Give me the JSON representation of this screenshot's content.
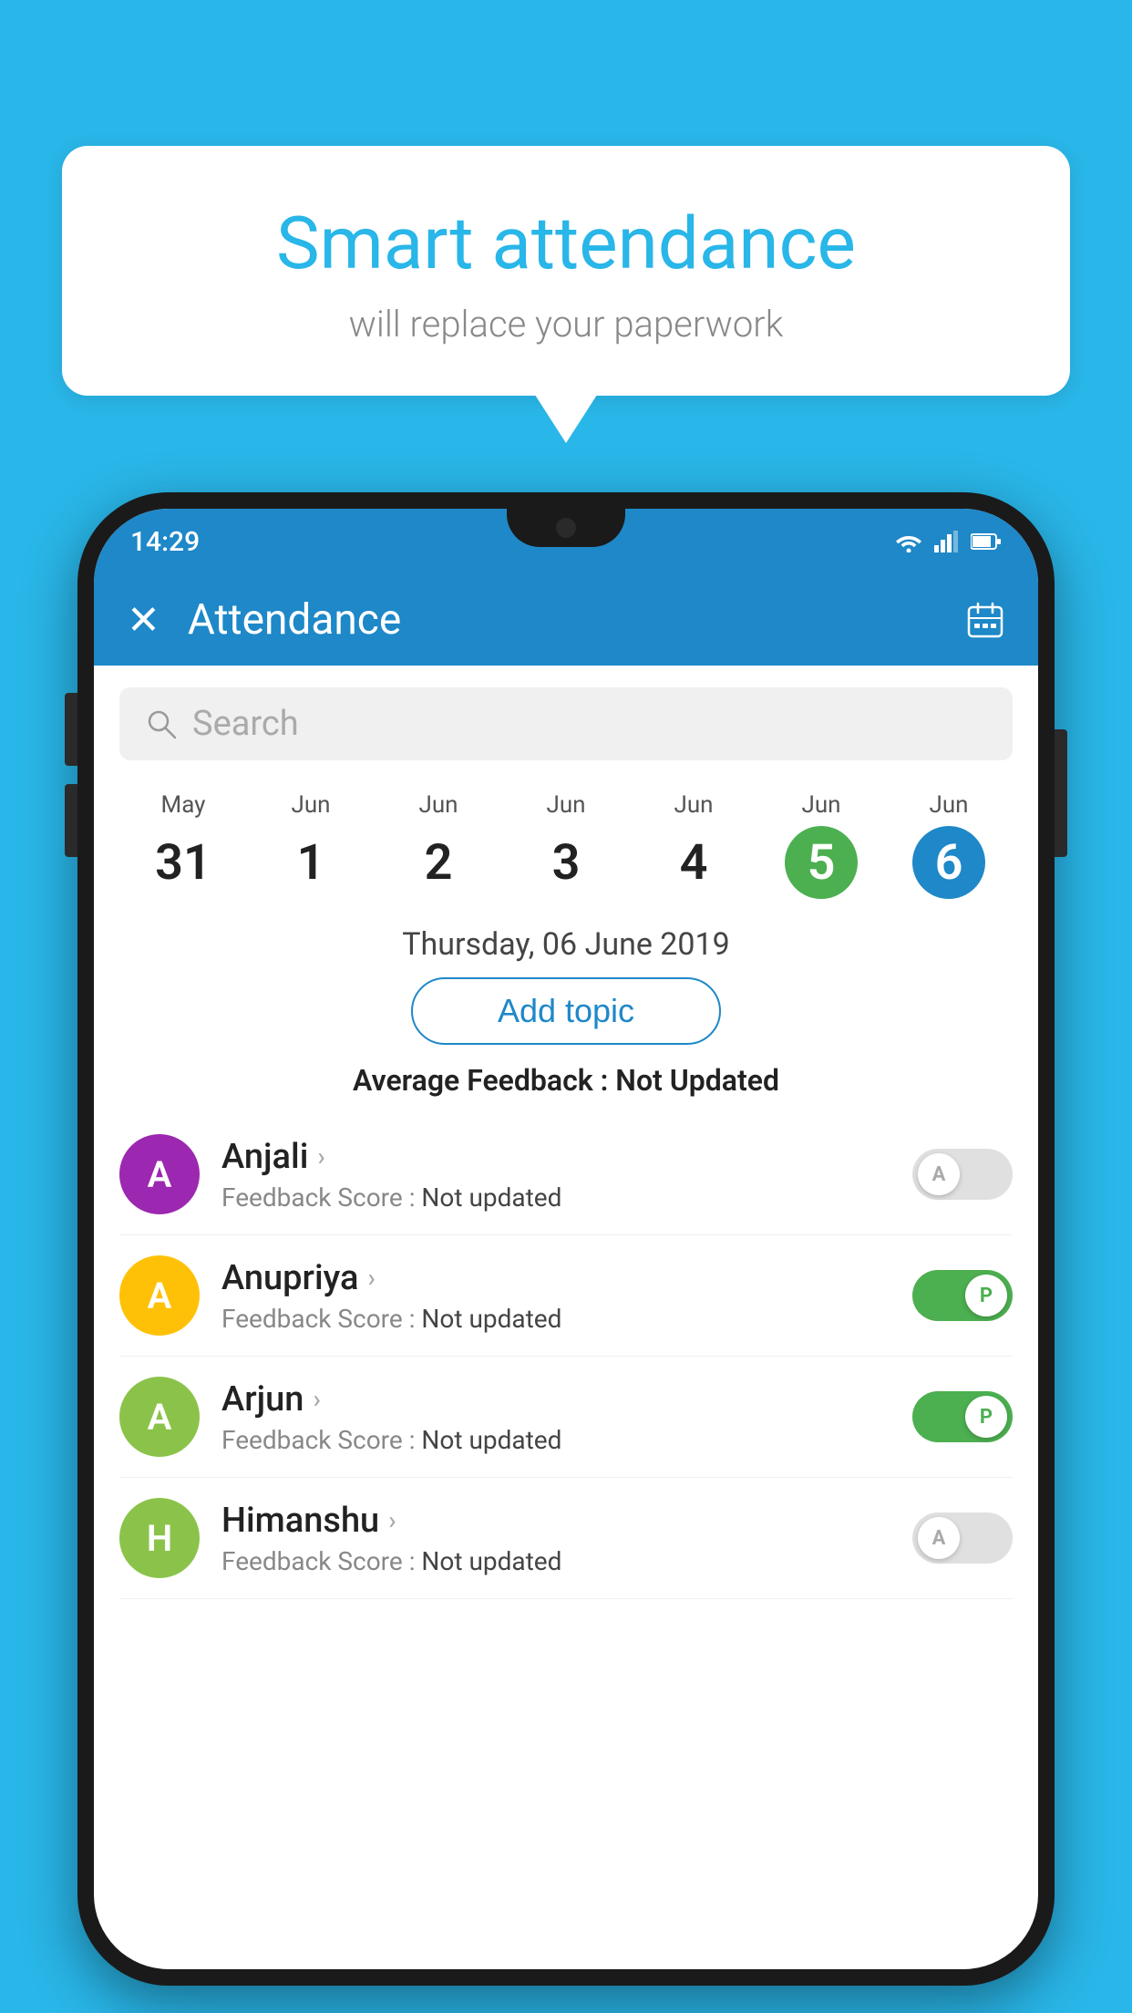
{
  "background_color": "#29B6E8",
  "bubble": {
    "title": "Smart attendance",
    "subtitle": "will replace your paperwork"
  },
  "status_bar": {
    "time": "14:29",
    "icons": [
      "wifi",
      "signal",
      "battery"
    ]
  },
  "app_bar": {
    "title": "Attendance",
    "close_label": "×",
    "calendar_label": "📅"
  },
  "search": {
    "placeholder": "Search"
  },
  "calendar": {
    "dates": [
      {
        "month": "May",
        "day": "31",
        "state": "normal"
      },
      {
        "month": "Jun",
        "day": "1",
        "state": "normal"
      },
      {
        "month": "Jun",
        "day": "2",
        "state": "normal"
      },
      {
        "month": "Jun",
        "day": "3",
        "state": "normal"
      },
      {
        "month": "Jun",
        "day": "4",
        "state": "normal"
      },
      {
        "month": "Jun",
        "day": "5",
        "state": "today"
      },
      {
        "month": "Jun",
        "day": "6",
        "state": "selected"
      }
    ],
    "selected_date_label": "Thursday, 06 June 2019"
  },
  "add_topic_label": "Add topic",
  "avg_feedback_label": "Average Feedback :",
  "avg_feedback_value": "Not Updated",
  "students": [
    {
      "name": "Anjali",
      "avatar_letter": "A",
      "avatar_color": "#9C27B0",
      "feedback_label": "Feedback Score :",
      "feedback_value": "Not updated",
      "toggle_state": "off",
      "toggle_letter": "A"
    },
    {
      "name": "Anupriya",
      "avatar_letter": "A",
      "avatar_color": "#FFC107",
      "feedback_label": "Feedback Score :",
      "feedback_value": "Not updated",
      "toggle_state": "on",
      "toggle_letter": "P"
    },
    {
      "name": "Arjun",
      "avatar_letter": "A",
      "avatar_color": "#8BC34A",
      "feedback_label": "Feedback Score :",
      "feedback_value": "Not updated",
      "toggle_state": "on",
      "toggle_letter": "P"
    },
    {
      "name": "Himanshu",
      "avatar_letter": "H",
      "avatar_color": "#8BC34A",
      "feedback_label": "Feedback Score :",
      "feedback_value": "Not updated",
      "toggle_state": "off",
      "toggle_letter": "A"
    }
  ]
}
